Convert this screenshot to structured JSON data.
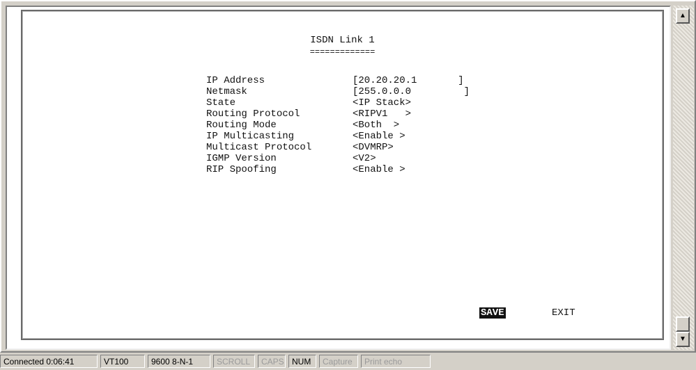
{
  "screen": {
    "title": "ISDN Link 1",
    "title_underline": "=============",
    "fields": [
      {
        "label": "IP Address",
        "value": "[20.20.20.1       ]"
      },
      {
        "label": "Netmask",
        "value": "[255.0.0.0         ]"
      },
      {
        "label": "State",
        "value": "<IP Stack>"
      },
      {
        "label": "Routing Protocol",
        "value": "<RIPV1   >"
      },
      {
        "label": "Routing Mode",
        "value": "<Both  >"
      },
      {
        "label": "IP Multicasting",
        "value": "<Enable >"
      },
      {
        "label": "Multicast Protocol",
        "value": "<DVMRP>"
      },
      {
        "label": "IGMP Version",
        "value": "<V2>"
      },
      {
        "label": "RIP Spoofing",
        "value": "<Enable >"
      }
    ],
    "save_label": "SAVE",
    "exit_label": "EXIT"
  },
  "scrollbar": {
    "up_icon": "▲",
    "down_icon": "▼"
  },
  "status_bar": {
    "connected": "Connected 0:06:41",
    "terminal": "VT100",
    "port": "9600 8-N-1",
    "scroll": "SCROLL",
    "caps": "CAPS",
    "num": "NUM",
    "capture": "Capture",
    "print_echo": "Print echo"
  }
}
